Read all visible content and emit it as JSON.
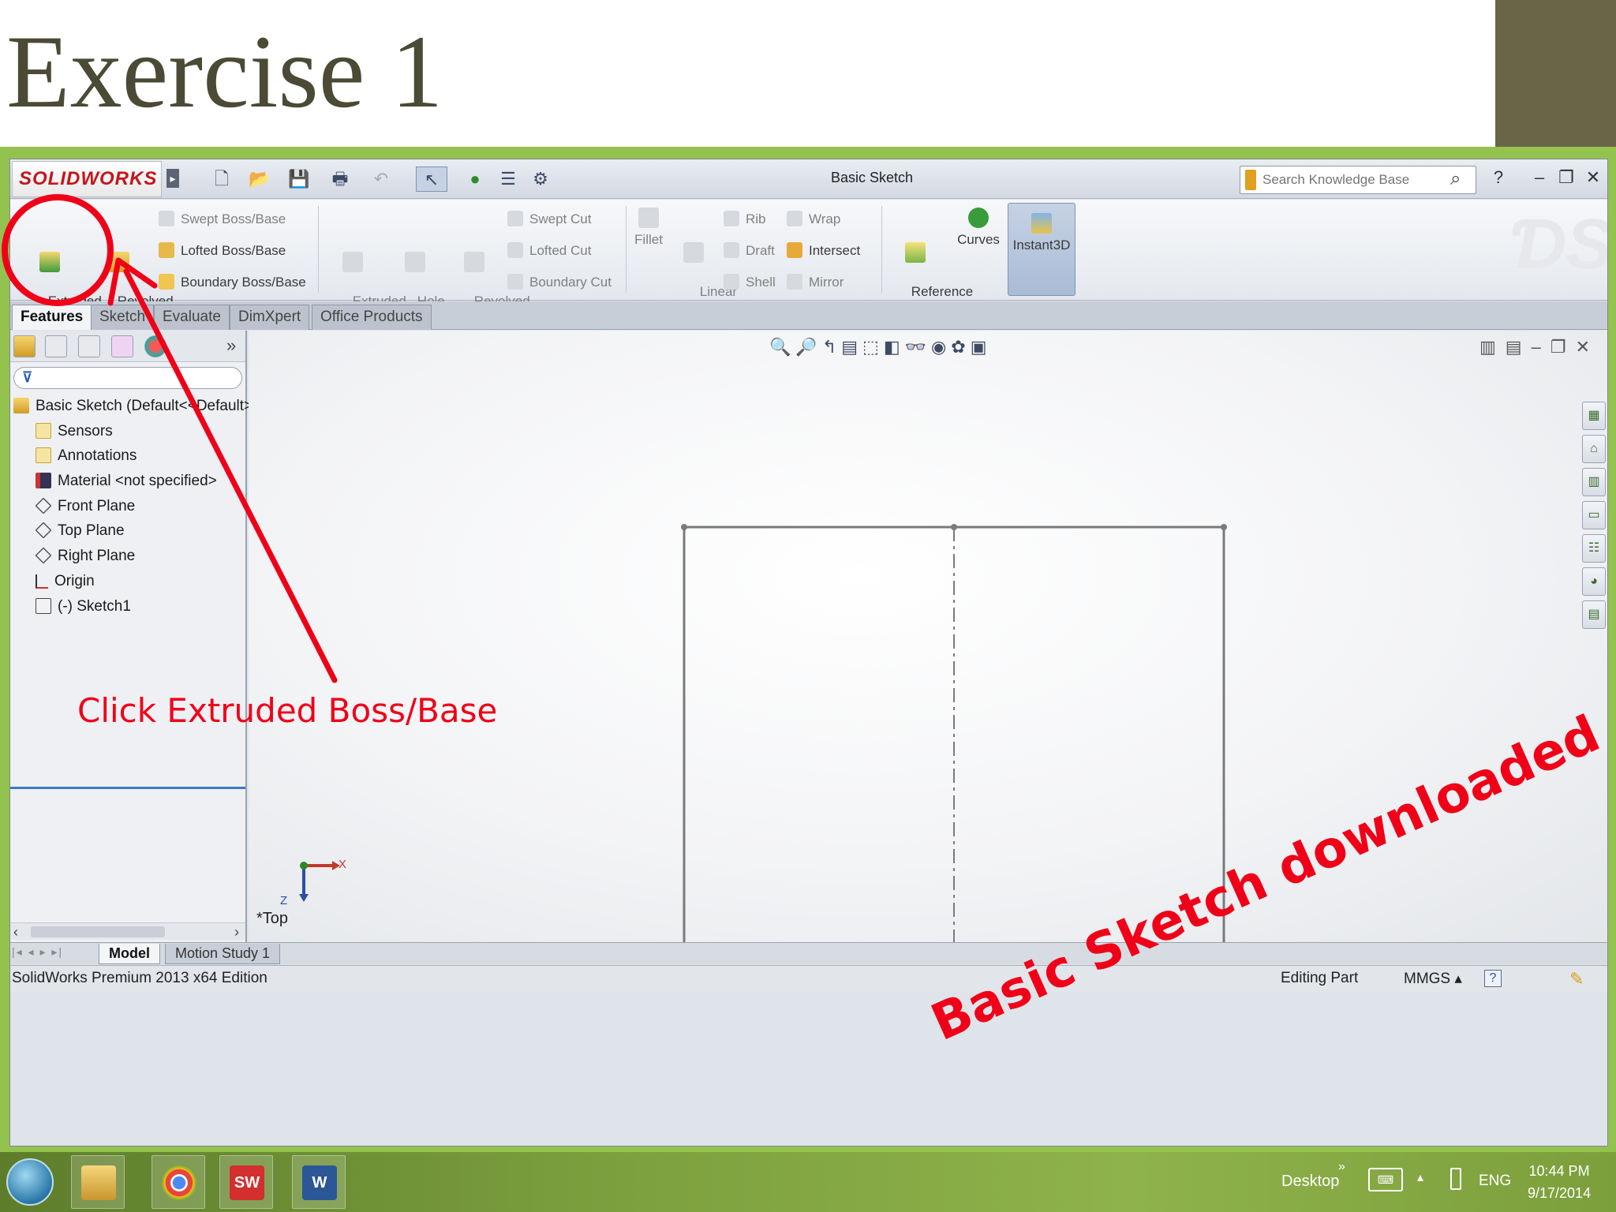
{
  "slide": {
    "title": "Exercise 1"
  },
  "app": {
    "logo": "SOLIDWORKS",
    "window_title": "Basic Sketch",
    "search": {
      "placeholder": "Search Knowledge Base"
    }
  },
  "commands": {
    "extruded_boss": "Extruded\nBoss/Base",
    "revolved_boss": "Revolved\nBoss/Base",
    "swept_boss": "Swept Boss/Base",
    "lofted_boss": "Lofted Boss/Base",
    "boundary_boss": "Boundary Boss/Base",
    "extruded_cut": "Extruded\nCut",
    "hole_wizard": "Hole\nWizard",
    "revolved_cut": "Revolved\nCut",
    "swept_cut": "Swept Cut",
    "lofted_cut": "Lofted Cut",
    "boundary_cut": "Boundary Cut",
    "fillet": "Fillet",
    "linear_pattern": "Linear\nPattern",
    "rib": "Rib",
    "draft": "Draft",
    "shell": "Shell",
    "wrap": "Wrap",
    "intersect": "Intersect",
    "mirror": "Mirror",
    "reference_geometry": "Reference\nGeometry",
    "curves": "Curves",
    "instant3d": "Instant3D"
  },
  "tabs": [
    "Features",
    "Sketch",
    "Evaluate",
    "DimXpert",
    "Office Products"
  ],
  "tree": {
    "root": "Basic Sketch  (Default<<Default>",
    "items": [
      {
        "label": "Sensors",
        "icon": "sensor-icon"
      },
      {
        "label": "Annotations",
        "icon": "annotation-icon"
      },
      {
        "label": "Material <not specified>",
        "icon": "material-icon"
      },
      {
        "label": "Front Plane",
        "icon": "plane-icon"
      },
      {
        "label": "Top Plane",
        "icon": "plane-icon"
      },
      {
        "label": "Right Plane",
        "icon": "plane-icon"
      },
      {
        "label": "Origin",
        "icon": "origin-icon"
      },
      {
        "label": "(-) Sketch1",
        "icon": "sketch-icon"
      }
    ]
  },
  "viewport": {
    "view_label": "*Top",
    "axis_x": "X",
    "axis_y": "Z"
  },
  "bottom_tabs": [
    "Model",
    "Motion Study 1"
  ],
  "status": {
    "edition": "SolidWorks Premium 2013 x64 Edition",
    "mode": "Editing Part",
    "units": "MMGS"
  },
  "taskbar": {
    "desktop": "Desktop",
    "lang": "ENG",
    "time": "10:44 PM",
    "date": "9/17/2014",
    "apps": [
      "explorer-icon",
      "chrome-icon",
      "solidworks-icon",
      "word-icon"
    ]
  },
  "annotations": {
    "click_note": "Click Extruded Boss/Base",
    "download_note": "Basic Sketch downloaded"
  },
  "colors": {
    "annotation_red": "#f00018",
    "frame_green": "#94c24f",
    "title_brown": "#4b4a35"
  }
}
